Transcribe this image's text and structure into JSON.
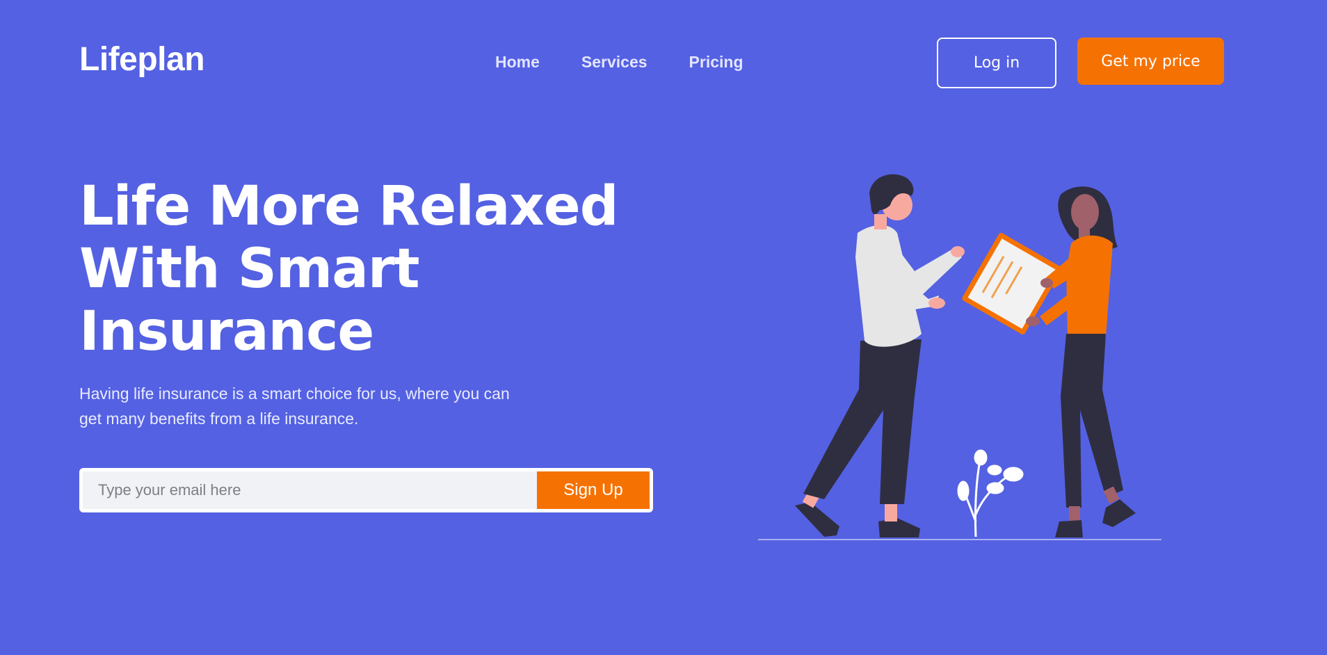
{
  "header": {
    "logo": "Lifeplan",
    "nav": [
      {
        "label": "Home"
      },
      {
        "label": "Services"
      },
      {
        "label": "Pricing"
      }
    ],
    "login_label": "Log in",
    "cta_label": "Get my price"
  },
  "hero": {
    "title_lines": [
      "Life More Relaxed",
      "With Smart",
      "Insurance"
    ],
    "subtitle": "Having life insurance is a smart choice for us, where you can get many benefits from a life insurance.",
    "email_placeholder": "Type your email here",
    "signup_label": "Sign Up"
  },
  "colors": {
    "background": "#5461e2",
    "accent": "#f57202",
    "dark": "#2f2e41",
    "light": "#e6e6e6"
  },
  "illustration": {
    "icon": "people-with-clipboard-illustration"
  }
}
